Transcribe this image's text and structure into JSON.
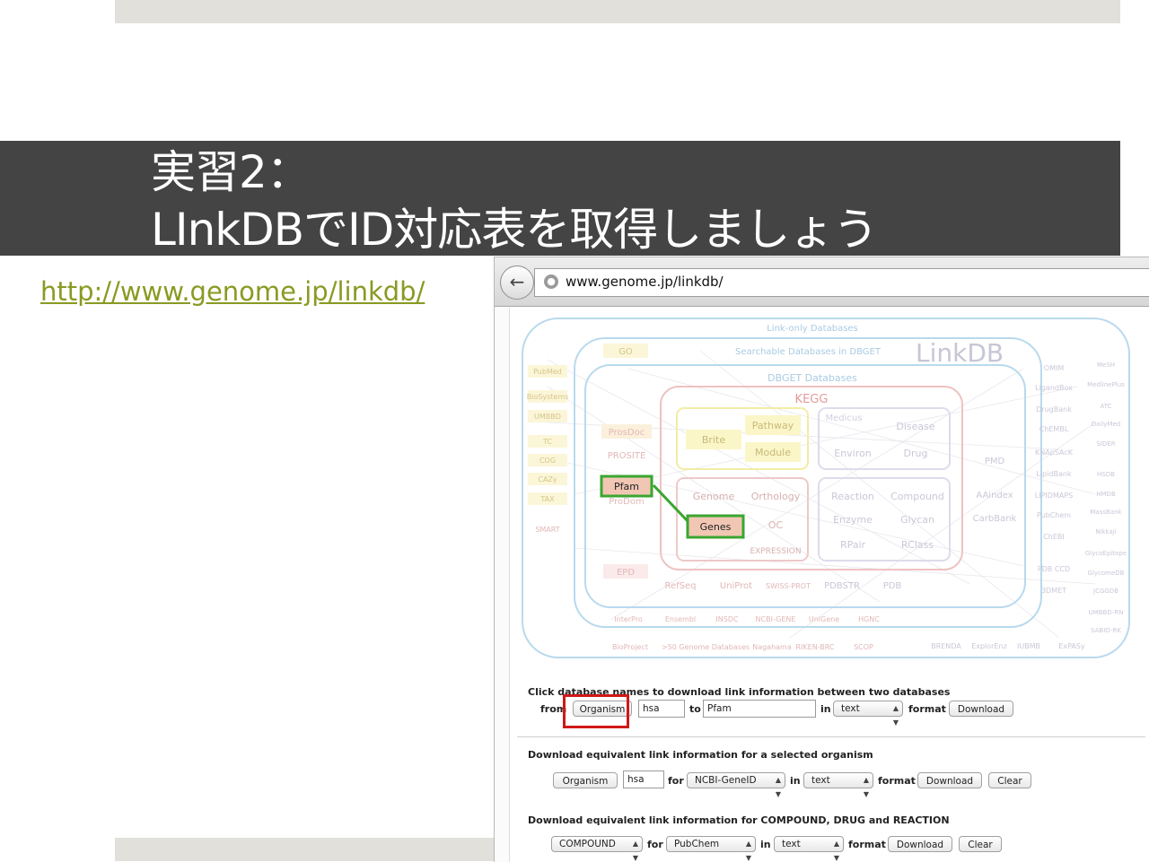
{
  "slide": {
    "title_line1": "実習2：",
    "title_line2": "LInkDBでID対応表を取得しましょう",
    "link": "http://www.genome.jp/linkdb/"
  },
  "browser": {
    "url": "www.genome.jp/linkdb/",
    "back_icon": "back-arrow-icon",
    "globe_icon": "globe-icon"
  },
  "diagram": {
    "link_only_label": "Link-only Databases",
    "searchable_label": "Searchable Databases in DBGET",
    "dbget_label": "DBGET Databases",
    "kegg_label": "KEGG",
    "logo_text": "LinkDB",
    "kegg_items": [
      "Pathway",
      "Brite",
      "Module",
      "Disease",
      "Environ",
      "Drug",
      "Genome",
      "Orthology",
      "OC",
      "EXPRESSION",
      "Reaction",
      "Compound",
      "Enzyme",
      "Glycan",
      "RPair",
      "RClass"
    ],
    "medicus_label": "Medicus",
    "highlight_pfam": "Pfam",
    "highlight_genes": "Genes",
    "dbget_items": [
      "GO",
      "ProsDoc",
      "PROSITE",
      "ProDom",
      "EPD",
      "RefSeq",
      "UniProt",
      "SWISS-PROT",
      "PDBSTR",
      "PDB",
      "PMD",
      "AAindex",
      "CarbBank",
      "InterPro",
      "Ensembl",
      "INSDC",
      "NCBI-GENE",
      "UniGene",
      "HGNC",
      "BioProject",
      ">50 Genome Databases",
      "Nagahama",
      "RIKEN-BRC",
      "SCOP",
      "BRENDA",
      "ExplorEnz",
      "IUBMB",
      "ExPASy"
    ],
    "left_items": [
      "PubMed",
      "BioSystems",
      "UMBBD",
      "TC",
      "COG",
      "CAZy",
      "TAX",
      "SMART"
    ],
    "right_items": [
      "OMIM",
      "LigandBox",
      "DrugBank",
      "ChEMBL",
      "KNApSAcK",
      "LipidBank",
      "LIPIDMAPS",
      "PubChem",
      "ChEBI",
      "PDB CCD",
      "3DMET"
    ],
    "far_right_items": [
      "MeSH",
      "MedlinePlus",
      "ATC",
      "DailyMed",
      "SIDER",
      "HSDB",
      "HMDB",
      "MassBank",
      "Nikkaji",
      "GlycoEpitope",
      "GlycomeDB",
      "JCGGDB",
      "UMBBD-RN",
      "SABIO-RK"
    ]
  },
  "form1": {
    "title": "Click database names to download link information between two databases",
    "from_label": "from",
    "organism_button": "Organism",
    "org_value": "hsa",
    "to_label": "to",
    "to_value": "Pfam",
    "in_label": "in",
    "format_select": "text",
    "format_label": "format",
    "download_button": "Download"
  },
  "form2": {
    "title": "Download equivalent link information for a selected organism",
    "organism_button": "Organism",
    "org_value": "hsa",
    "for_label": "for",
    "db_select": "NCBI-GeneID",
    "in_label": "in",
    "format_select": "text",
    "format_label": "format",
    "download_button": "Download",
    "clear_button": "Clear"
  },
  "form3": {
    "title": "Download equivalent link information for COMPOUND, DRUG and REACTION",
    "type_select": "COMPOUND",
    "for_label": "for",
    "db_select": "PubChem",
    "in_label": "in",
    "format_select": "text",
    "format_label": "format",
    "download_button": "Download",
    "clear_button": "Clear"
  },
  "colors": {
    "title_band": "#444444",
    "link": "#8a9a22",
    "highlight_red": "#d01818",
    "highlight_green": "#3aa630"
  }
}
